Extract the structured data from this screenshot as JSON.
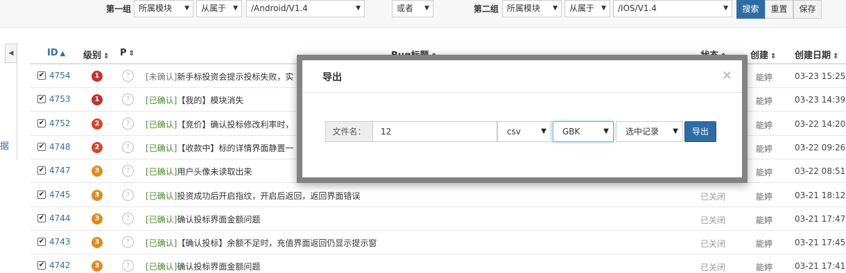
{
  "search_bar": {
    "group1_label": "第一组",
    "group1_field": "所属模块",
    "group1_operator": "从属于",
    "group1_value": "/Android/V1.4",
    "logic": "或者",
    "group2_label": "第二组",
    "group2_field": "所属模块",
    "group2_operator": "从属于",
    "group2_value": "/IOS/V1.4",
    "search_button": "搜索",
    "reset_button": "重置",
    "save_button": "保存"
  },
  "side_panel": {
    "toggle_icon": "◀",
    "text": "据"
  },
  "table": {
    "columns": {
      "id": "ID",
      "severity": "级别",
      "priority": "P",
      "title": "Bug标题",
      "status": "状态",
      "creator": "创建",
      "created_date": "创建日期"
    },
    "rows": [
      {
        "id": "4754",
        "severity": "1",
        "priority": "?",
        "tag": "[未确认]",
        "title": "新手标投资会提示投标失败，实",
        "status": "",
        "creator": "能婷",
        "date": "03-23 15:25"
      },
      {
        "id": "4753",
        "severity": "1",
        "priority": "?",
        "tag": "[已确认]",
        "title": "【我的】模块消失",
        "status": "",
        "creator": "能婷",
        "date": "03-23 14:39"
      },
      {
        "id": "4752",
        "severity": "2",
        "priority": "?",
        "tag": "[已确认]",
        "title": "【竞价】确认投标修改利率时，",
        "status": "",
        "creator": "能婷",
        "date": "03-22 14:20"
      },
      {
        "id": "4748",
        "severity": "2",
        "priority": "?",
        "tag": "[已确认]",
        "title": "【收款中】标的详情界面静置一",
        "status": "",
        "creator": "能婷",
        "date": "03-22 09:26"
      },
      {
        "id": "4747",
        "severity": "3",
        "priority": "?",
        "tag": "[已确认]",
        "title": "用户头像未读取出来",
        "status": "",
        "creator": "能婷",
        "date": "03-22 08:51"
      },
      {
        "id": "4745",
        "severity": "3",
        "priority": "?",
        "tag": "[已确认]",
        "title": "投资成功后开启指纹，开启后返回，返回界面错误",
        "status": "已关闭",
        "creator": "能婷",
        "date": "03-21 18:12"
      },
      {
        "id": "4744",
        "severity": "3",
        "priority": "?",
        "tag": "[已确认]",
        "title": "确认投标界面金额问题",
        "status": "已关闭",
        "creator": "能婷",
        "date": "03-21 17:47"
      },
      {
        "id": "4743",
        "severity": "3",
        "priority": "?",
        "tag": "[已确认]",
        "title": "【确认投标】余额不足时，充值界面返回仍显示提示窗",
        "status": "已关闭",
        "creator": "能婷",
        "date": "03-21 17:45"
      },
      {
        "id": "4742",
        "severity": "3",
        "priority": "?",
        "tag": "[已确认]",
        "title": "确认投标界面金额问题",
        "status": "已关闭",
        "creator": "能婷",
        "date": "03-21 17:41"
      }
    ]
  },
  "severity_colors": {
    "1": "#c9302c",
    "2": "#d9442a",
    "3": "#e08a1e"
  },
  "modal": {
    "title": "导出",
    "close_icon": "×",
    "filename_label": "文件名：",
    "filename_value": "12",
    "format_value": "csv",
    "encoding_value": "GBK",
    "records_value": "选中记录",
    "export_button": "导出"
  }
}
